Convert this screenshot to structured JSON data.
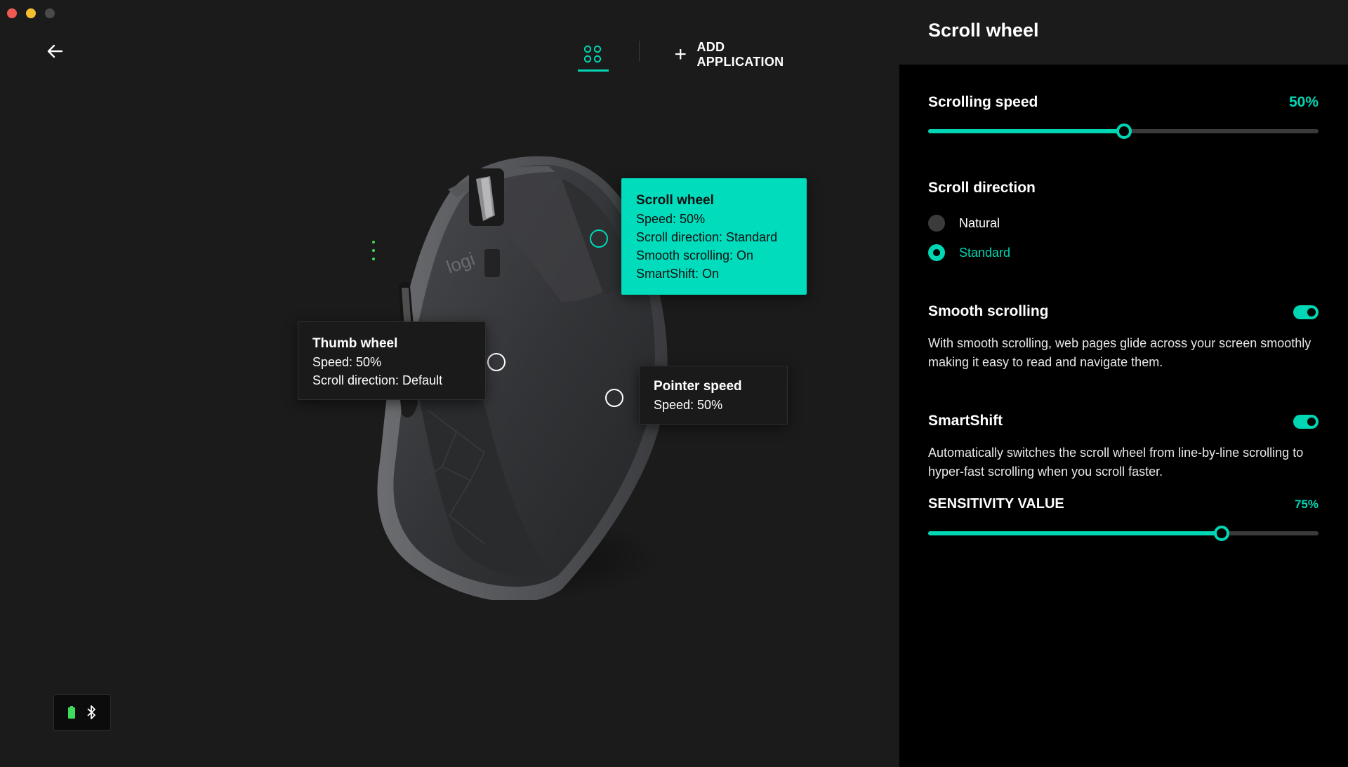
{
  "topnav": {
    "add_application": "ADD APPLICATION"
  },
  "callouts": {
    "scroll_wheel": {
      "title": "Scroll wheel",
      "lines": [
        "Speed: 50%",
        "Scroll direction: Standard",
        "Smooth scrolling: On",
        "SmartShift: On"
      ]
    },
    "thumb_wheel": {
      "title": "Thumb wheel",
      "lines": [
        "Speed: 50%",
        "Scroll direction: Default"
      ]
    },
    "pointer_speed": {
      "title": "Pointer speed",
      "lines": [
        "Speed: 50%"
      ]
    }
  },
  "mouse": {
    "logo_text": "logi"
  },
  "panel": {
    "title": "Scroll wheel",
    "scrolling_speed": {
      "label": "Scrolling speed",
      "value_text": "50%",
      "value": 0.5
    },
    "scroll_direction": {
      "label": "Scroll direction",
      "options": [
        {
          "label": "Natural",
          "selected": false
        },
        {
          "label": "Standard",
          "selected": true
        }
      ]
    },
    "smooth_scrolling": {
      "label": "Smooth scrolling",
      "enabled": true,
      "description": "With smooth scrolling, web pages glide across your screen smoothly making it easy to read and navigate them."
    },
    "smartshift": {
      "label": "SmartShift",
      "enabled": true,
      "description": "Automatically switches the scroll wheel from line-by-line scrolling to hyper-fast scrolling when you scroll faster."
    },
    "sensitivity": {
      "label": "SENSITIVITY VALUE",
      "value_text": "75%",
      "value": 0.75
    }
  },
  "colors": {
    "accent": "#00d6b4",
    "panel_bg": "#000000",
    "window_bg": "#1b1b1b"
  },
  "icons": [
    "back-arrow-icon",
    "app-grid-icon",
    "plus-icon",
    "battery-icon",
    "bluetooth-icon"
  ]
}
